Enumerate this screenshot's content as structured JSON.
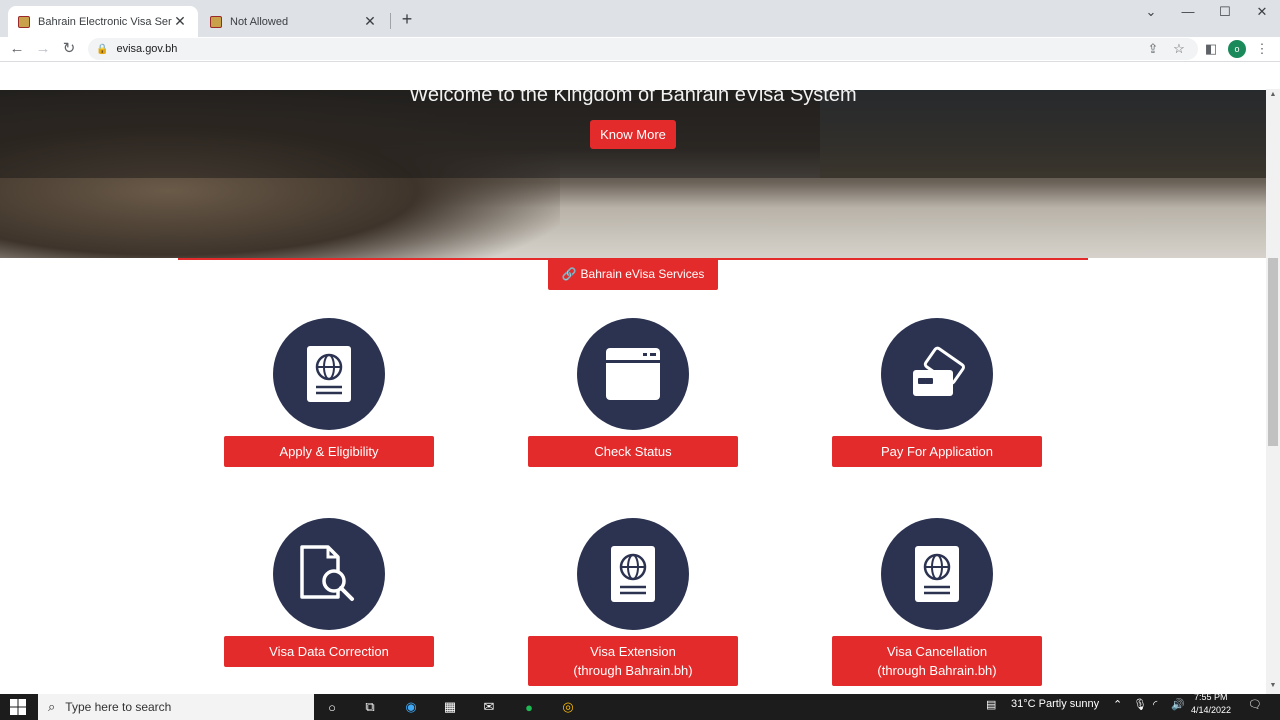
{
  "browser": {
    "tabs": [
      {
        "title": "Bahrain Electronic Visa Service",
        "active": true
      },
      {
        "title": "Not Allowed",
        "active": false
      }
    ],
    "new_tab_icon": "+",
    "url": "evisa.gov.bh",
    "profile_initial": "o"
  },
  "hero": {
    "title": "Welcome to the Kingdom of Bahrain eVisa System",
    "know_more": "Know More"
  },
  "services": {
    "heading": "Bahrain eVisa Services",
    "items": [
      {
        "icon": "passport-icon",
        "line1": "Apply & Eligibility",
        "line2": ""
      },
      {
        "icon": "browser-window-icon",
        "line1": "Check Status",
        "line2": ""
      },
      {
        "icon": "credit-card-icon",
        "line1": "Pay For Application",
        "line2": ""
      },
      {
        "icon": "document-search-icon",
        "line1": "Visa Data Correction",
        "line2": ""
      },
      {
        "icon": "passport-icon",
        "line1": "Visa Extension",
        "line2": "(through Bahrain.bh)"
      },
      {
        "icon": "passport-icon",
        "line1": "Visa Cancellation",
        "line2": "(through Bahrain.bh)"
      }
    ]
  },
  "taskbar": {
    "search_placeholder": "Type here to search",
    "weather": "31°C  Partly sunny",
    "time": "7:55 PM",
    "date": "4/14/2022"
  },
  "colors": {
    "accent": "#e32b2b",
    "icon_circle": "#2b3350"
  }
}
